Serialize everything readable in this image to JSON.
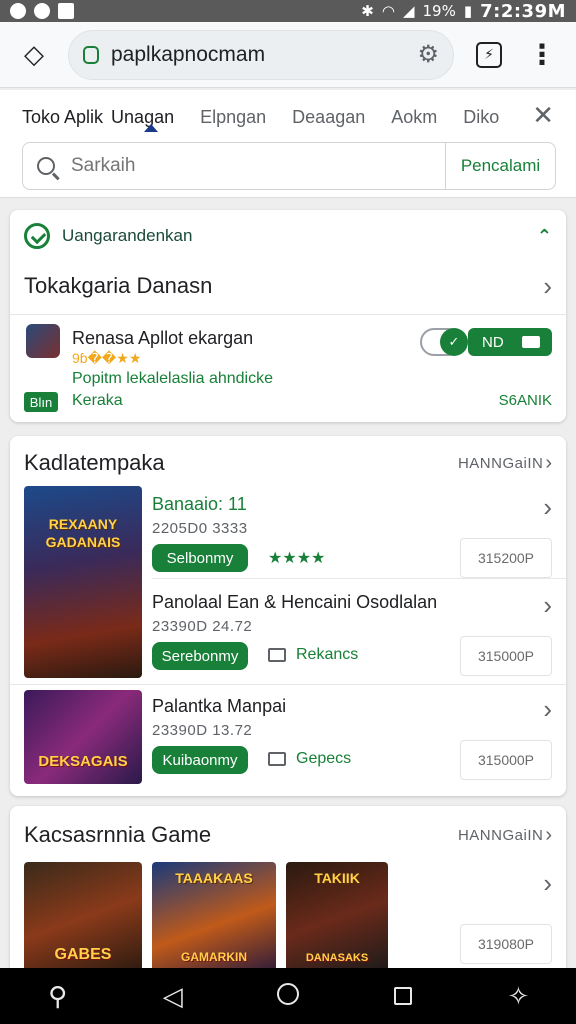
{
  "status_bar": {
    "battery": "19%",
    "time": "7:2:39M"
  },
  "url_bar": {
    "url": "paplkapnocmam",
    "tabs_count": "⚡"
  },
  "tabs": {
    "items": [
      "Toko Aplik",
      "Unagan",
      "Elpngan",
      "Deaagan",
      "Aokm",
      "Diko"
    ],
    "active": "Unagan"
  },
  "search": {
    "placeholder": "Sarkaih",
    "button_label": "Pencalami"
  },
  "update_card": {
    "banner": "Uangarandenkan",
    "heading": "Tokakgaria Danasn",
    "app_name": "Renasa Apllot ekargan",
    "stars": "9ɓ��★★",
    "description": "Popitm lekalelaslia ahndicke",
    "badge": "Blın",
    "link": "Keraka",
    "toggle_label": "ND",
    "size": "S6ANIK",
    "accent": "#188038"
  },
  "featured": {
    "title": "Kadlatempaka",
    "more_label": "HANNGaiIN",
    "games": [
      {
        "name": "Banaaio: 11",
        "meta": "2205D0 3333",
        "button": "Selbonmy",
        "tag": "★★★★",
        "price": "315200P",
        "art_top": "REXAANY",
        "art_bottom": "GADANAIS"
      },
      {
        "name": "Panolaal Ean  & Hencaini Osodlalan",
        "meta": "23390D 24.72",
        "button": "Serebonmy",
        "tag": "Rekancs",
        "price": "315000P"
      },
      {
        "name": "Palantka Manpai",
        "meta": "23390D 13.72",
        "button": "Kuibaonmy",
        "tag": "Gepecs",
        "price": "315000P",
        "art_bottom": "DEKSAGAIS"
      }
    ]
  },
  "games_section": {
    "title": "Kacsasrnnia Game",
    "more_label": "HANNGaiIN",
    "tiles": [
      {
        "top": "",
        "bottom": "GABES"
      },
      {
        "top": "TAAAKAAS",
        "bottom": "GAMARKIN"
      },
      {
        "top": "TAKIIK",
        "bottom": "DANASAKS"
      }
    ],
    "price": "319080P"
  }
}
